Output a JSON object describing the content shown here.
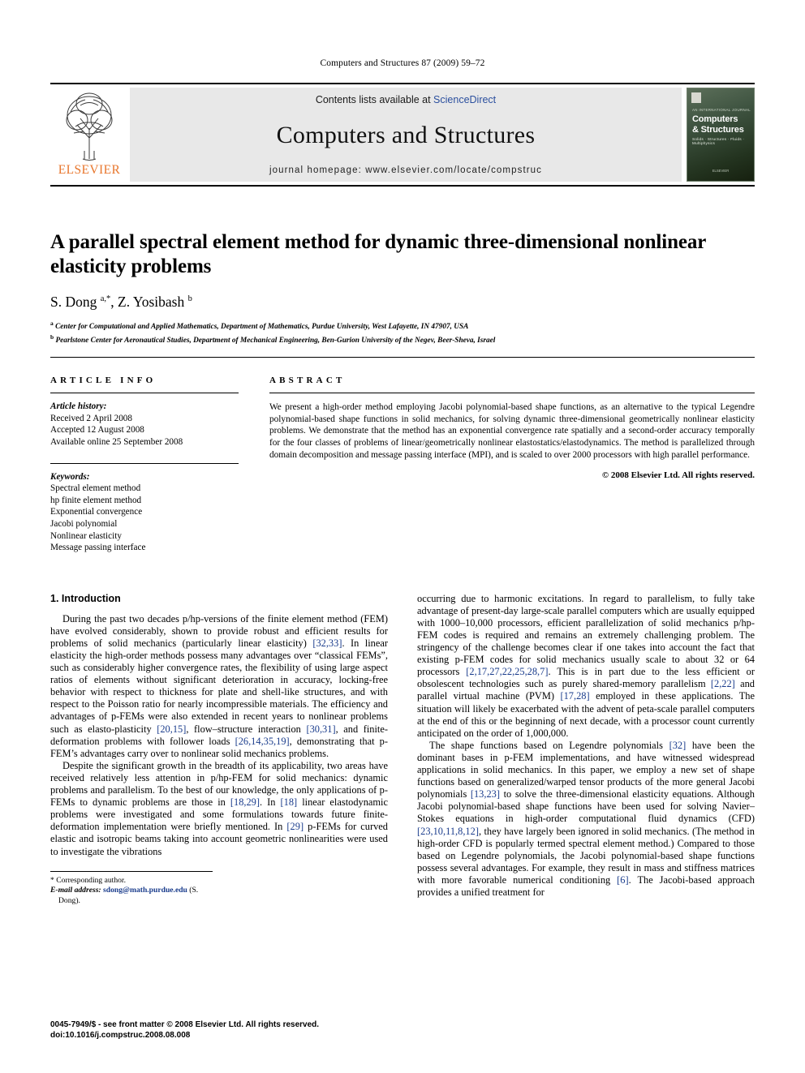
{
  "running_head": "Computers and Structures 87 (2009) 59–72",
  "masthead": {
    "contents_prefix": "Contents lists available at ",
    "sciencedirect": "ScienceDirect",
    "journal_title": "Computers and Structures",
    "homepage": "journal homepage: www.elsevier.com/locate/compstruc",
    "publisher": "ELSEVIER",
    "cover": {
      "eyebrow": "AN INTERNATIONAL JOURNAL",
      "title_line1": "Computers",
      "title_line2": "& Structures",
      "subtitle": "Solids · Structures · Fluids · Multiphysics",
      "footer": "ELSEVIER"
    }
  },
  "article": {
    "title": "A parallel spectral element method for dynamic three-dimensional nonlinear elasticity problems",
    "authors_html": "S. Dong <sup>a,*</sup>, Z. Yosibash <sup>b</sup>",
    "affiliation_a": "Center for Computational and Applied Mathematics, Department of Mathematics, Purdue University, West Lafayette, IN 47907, USA",
    "affiliation_b": "Pearlstone Center for Aeronautical Studies, Department of Mechanical Engineering, Ben-Gurion University of the Negev, Beer-Sheva, Israel"
  },
  "info": {
    "heading": "ARTICLE INFO",
    "history_label": "Article history:",
    "received": "Received 2 April 2008",
    "accepted": "Accepted 12 August 2008",
    "available": "Available online 25 September 2008",
    "keywords_label": "Keywords:",
    "keywords": [
      "Spectral element method",
      "hp finite element method",
      "Exponential convergence",
      "Jacobi polynomial",
      "Nonlinear elasticity",
      "Message passing interface"
    ]
  },
  "abstract": {
    "heading": "ABSTRACT",
    "text": "We present a high-order method employing Jacobi polynomial-based shape functions, as an alternative to the typical Legendre polynomial-based shape functions in solid mechanics, for solving dynamic three-dimensional geometrically nonlinear elasticity problems. We demonstrate that the method has an exponential convergence rate spatially and a second-order accuracy temporally for the four classes of problems of linear/geometrically nonlinear elastostatics/elastodynamics. The method is parallelized through domain decomposition and message passing interface (MPI), and is scaled to over 2000 processors with high parallel performance.",
    "copyright": "© 2008 Elsevier Ltd. All rights reserved."
  },
  "body": {
    "section_heading": "1. Introduction",
    "left_p1_a": "During the past two decades p/hp-versions of the finite element method (FEM) have evolved considerably, shown to provide robust and efficient results for problems of solid mechanics (particularly linear elasticity) ",
    "left_p1_c1": "[32,33]",
    "left_p1_b": ". In linear elasticity the high-order methods possess many advantages over “classical FEMs”, such as considerably higher convergence rates, the flexibility of using large aspect ratios of elements without significant deterioration in accuracy, locking-free behavior with respect to thickness for plate and shell-like structures, and with respect to the Poisson ratio for nearly incompressible materials. The efficiency and advantages of p-FEMs were also extended in recent years to nonlinear problems such as elasto-plasticity ",
    "left_p1_c2": "[20,15]",
    "left_p1_d": ", flow–structure interaction ",
    "left_p1_c3": "[30,31]",
    "left_p1_e": ", and finite-deformation problems with follower loads ",
    "left_p1_c4": "[26,14,35,19]",
    "left_p1_f": ", demonstrating that p-FEM’s advantages carry over to nonlinear solid mechanics problems.",
    "left_p2_a": "Despite the significant growth in the breadth of its applicability, two areas have received relatively less attention in p/hp-FEM for solid mechanics: dynamic problems and parallelism. To the best of our knowledge, the only applications of p-FEMs to dynamic problems are those in ",
    "left_p2_c1": "[18,29]",
    "left_p2_b": ". In ",
    "left_p2_c2": "[18]",
    "left_p2_c": " linear elastodynamic problems were investigated and some formulations towards future finite-deformation implementation were briefly mentioned. In ",
    "left_p2_c3": "[29]",
    "left_p2_d": " p-FEMs for curved elastic and isotropic beams taking into account geometric nonlinearities were used to investigate the vibrations",
    "right_p1_a": "occurring due to harmonic excitations. In regard to parallelism, to fully take advantage of present-day large-scale parallel computers which are usually equipped with 1000–10,000 processors, efficient parallelization of solid mechanics p/hp-FEM codes is required and remains an extremely challenging problem. The stringency of the challenge becomes clear if one takes into account the fact that existing p-FEM codes for solid mechanics usually scale to about 32 or 64 processors ",
    "right_p1_c1": "[2,17,27,22,25,28,7]",
    "right_p1_b": ". This is in part due to the less efficient or obsolescent technologies such as purely shared-memory parallelism ",
    "right_p1_c2": "[2,22]",
    "right_p1_c": " and parallel virtual machine (PVM) ",
    "right_p1_c3": "[17,28]",
    "right_p1_d": " employed in these applications. The situation will likely be exacerbated with the advent of peta-scale parallel computers at the end of this or the beginning of next decade, with a processor count currently anticipated on the order of 1,000,000.",
    "right_p2_a": "The shape functions based on Legendre polynomials ",
    "right_p2_c1": "[32]",
    "right_p2_b": " have been the dominant bases in p-FEM implementations, and have witnessed widespread applications in solid mechanics. In this paper, we employ a new set of shape functions based on generalized/warped tensor products of the more general Jacobi polynomials ",
    "right_p2_c2": "[13,23]",
    "right_p2_c": " to solve the three-dimensional elasticity equations. Although Jacobi polynomial-based shape functions have been used for solving Navier–Stokes equations in high-order computational fluid dynamics (CFD) ",
    "right_p2_c3": "[23,10,11,8,12]",
    "right_p2_d": ", they have largely been ignored in solid mechanics. (The method in high-order CFD is popularly termed spectral element method.) Compared to those based on Legendre polynomials, the Jacobi polynomial-based shape functions possess several advantages. For example, they result in mass and stiffness matrices with more favorable numerical conditioning ",
    "right_p2_c4": "[6]",
    "right_p2_e": ". The Jacobi-based approach provides a unified treatment for"
  },
  "footnote": {
    "corresponding": "* Corresponding author.",
    "email_label": "E-mail address:",
    "email": "sdong@math.purdue.edu",
    "email_suffix": " (S. Dong)."
  },
  "page_footer": {
    "line1": "0045-7949/$ - see front matter © 2008 Elsevier Ltd. All rights reserved.",
    "line2": "doi:10.1016/j.compstruc.2008.08.008"
  }
}
